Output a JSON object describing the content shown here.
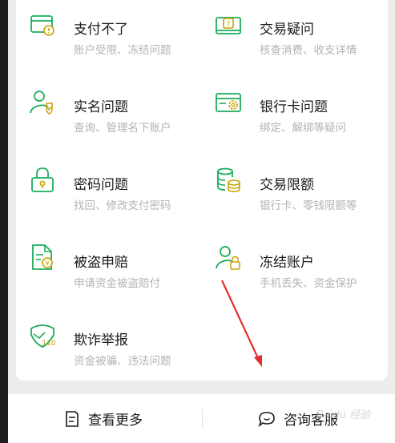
{
  "items": [
    {
      "title": "支付不了",
      "subtitle": "账户受限、冻结问题",
      "icon": "payment-card-alert-icon"
    },
    {
      "title": "交易疑问",
      "subtitle": "核查消费、收支详情",
      "icon": "wallet-question-icon"
    },
    {
      "title": "实名问题",
      "subtitle": "查询、管理名下账户",
      "icon": "user-verify-icon"
    },
    {
      "title": "银行卡问题",
      "subtitle": "绑定、解绑等疑问",
      "icon": "bank-card-gear-icon"
    },
    {
      "title": "密码问题",
      "subtitle": "找回、修改支付密码",
      "icon": "lock-icon"
    },
    {
      "title": "交易限额",
      "subtitle": "银行卡、零钱限额等",
      "icon": "coin-stack-icon"
    },
    {
      "title": "被盗申赔",
      "subtitle": "申请资金被盗赔付",
      "icon": "document-claim-icon"
    },
    {
      "title": "冻结账户",
      "subtitle": "手机丢失、资金保护",
      "icon": "user-lock-icon"
    },
    {
      "title": "欺诈举报",
      "subtitle": "资金被骗、违法问题",
      "icon": "fraud-report-icon"
    }
  ],
  "bottom": {
    "more_label": "查看更多",
    "consult_label": "咨询客服"
  },
  "watermark": "Baidu 经验",
  "colors": {
    "accent": "#1aad5a",
    "arrow": "#e03030"
  }
}
